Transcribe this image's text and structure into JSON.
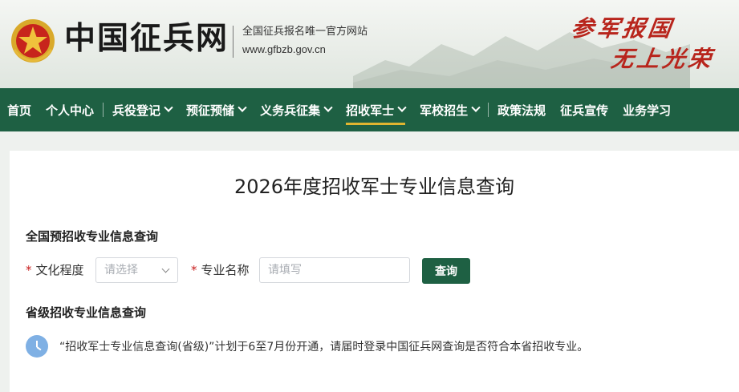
{
  "header": {
    "site_title": "中国征兵网",
    "tagline": "全国征兵报名唯一官方网站",
    "domain": "www.gfbzb.gov.cn",
    "calligraphy_line1": "参军报国",
    "calligraphy_line2": "无上光荣",
    "accent_red": "#b8251c"
  },
  "nav": {
    "background": "#1e6043",
    "items": [
      {
        "label": "首页",
        "dropdown": false
      },
      {
        "label": "个人中心",
        "dropdown": false
      },
      {
        "label": "兵役登记",
        "dropdown": true
      },
      {
        "label": "预征预储",
        "dropdown": true
      },
      {
        "label": "义务兵征集",
        "dropdown": true
      },
      {
        "label": "招收军士",
        "dropdown": true,
        "active": true
      },
      {
        "label": "军校招生",
        "dropdown": true
      },
      {
        "label": "政策法规",
        "dropdown": false
      },
      {
        "label": "征兵宣传",
        "dropdown": false
      },
      {
        "label": "业务学习",
        "dropdown": false
      }
    ]
  },
  "main": {
    "page_title": "2026年度招收军士专业信息查询",
    "national_section_title": "全国预招收专业信息查询",
    "education_label": "文化程度",
    "education_placeholder": "请选择",
    "major_label": "专业名称",
    "major_placeholder": "请填写",
    "query_button": "查询",
    "required_mark": "*",
    "provincial_section_title": "省级招收专业信息查询",
    "notice_text": "“招收军士专业信息查询(省级)”计划于6至7月份开通，请届时登录中国征兵网查询是否符合本省招收专业。"
  }
}
